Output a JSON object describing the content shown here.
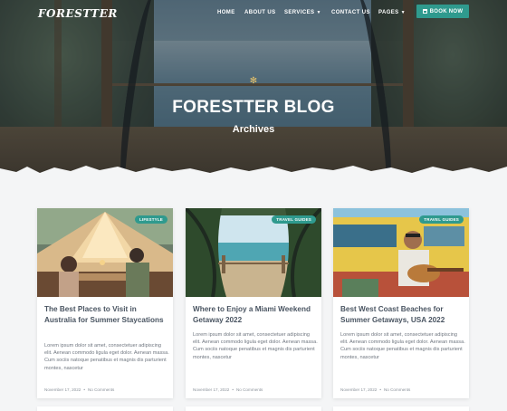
{
  "site": {
    "logo": "FORESTTER"
  },
  "nav": {
    "items": [
      {
        "label": "HOME",
        "dropdown": false
      },
      {
        "label": "ABOUT US",
        "dropdown": false
      },
      {
        "label": "SERVICES",
        "dropdown": true
      },
      {
        "label": "CONTACT US",
        "dropdown": false
      },
      {
        "label": "PAGES",
        "dropdown": true
      }
    ],
    "cta": {
      "label": "BOOK NOW",
      "icon": "calendar-icon"
    }
  },
  "hero": {
    "title": "FORESTTER BLOG",
    "subtitle": "Archives",
    "mark_icon": "sun-icon"
  },
  "colors": {
    "accent": "#2f9a8e",
    "title_text": "#4a5562",
    "body_text": "#707780"
  },
  "posts": [
    {
      "tag": "LIFESTYLE",
      "title": "The Best Places to Visit in Australia for Summer Staycations",
      "excerpt": "Lorem ipsum dolor sit amet, consectetuer adipiscing elit. Aenean commodo ligula eget dolor. Aenean massa. Cum sociis natoque penatibus et magnis dis parturient montes, nascetur",
      "date": "November 17, 2022",
      "comments": "No Comments"
    },
    {
      "tag": "TRAVEL GUIDES",
      "title": "Where to Enjoy a Miami Weekend Getaway 2022",
      "excerpt": "Lorem ipsum dolor sit amet, consectetuer adipiscing elit. Aenean commodo ligula eget dolor. Aenean massa. Cum sociis natoque penatibus et magnis dis parturient montes, nascetur",
      "date": "November 17, 2022",
      "comments": "No Comments"
    },
    {
      "tag": "TRAVEL GUIDES",
      "title": "Best West Coast Beaches for Summer Getaways, USA 2022",
      "excerpt": "Lorem ipsum dolor sit amet, consectetuer adipiscing elit. Aenean commodo ligula eget dolor. Aenean massa. Cum sociis natoque penatibus et magnis dis parturient montes, nascetur",
      "date": "November 17, 2022",
      "comments": "No Comments"
    }
  ]
}
